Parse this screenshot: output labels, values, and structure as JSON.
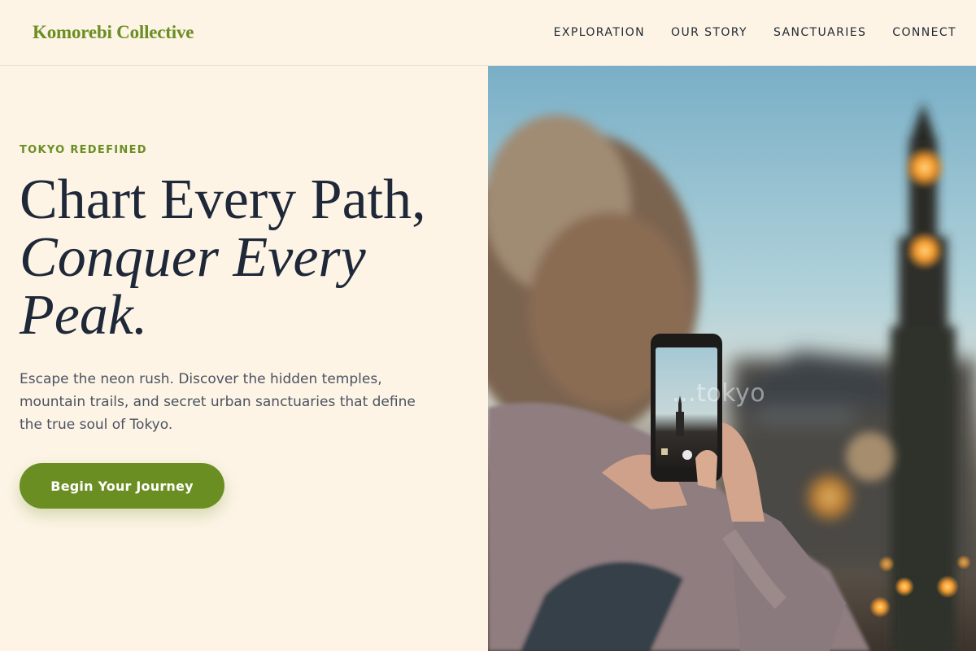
{
  "brand": {
    "name": "Komorebi Collective",
    "accent_color": "#6b8e23",
    "background_color": "#fdf4e6",
    "text_color": "#1e2838"
  },
  "nav": {
    "items": [
      {
        "label": "EXPLORATION"
      },
      {
        "label": "OUR STORY"
      },
      {
        "label": "SANCTUARIES"
      },
      {
        "label": "CONNECT"
      }
    ]
  },
  "hero": {
    "eyebrow": "TOKYO REDEFINED",
    "headline_line1": "Chart Every Path,",
    "headline_line2": "Conquer Every Peak.",
    "subtext": "Escape the neon rush. Discover the hidden temples, mountain trails, and secret urban sanctuaries that define the true soul of Tokyo.",
    "cta_label": "Begin Your Journey"
  },
  "photo": {
    "watermark": "...tokyo"
  }
}
